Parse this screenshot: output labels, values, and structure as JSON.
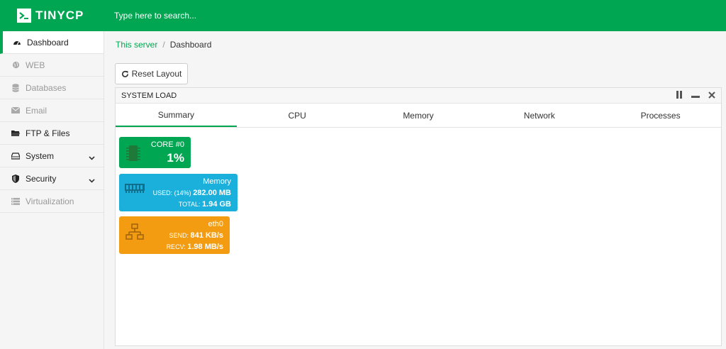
{
  "app": {
    "logo_text": "TINYCP"
  },
  "search": {
    "placeholder": "Type here to search..."
  },
  "sidebar": {
    "items": [
      {
        "label": "Dashboard",
        "icon": "dashboard-icon"
      },
      {
        "label": "WEB",
        "icon": "globe-icon"
      },
      {
        "label": "Databases",
        "icon": "database-icon"
      },
      {
        "label": "Email",
        "icon": "envelope-icon"
      },
      {
        "label": "FTP & Files",
        "icon": "folder-icon"
      },
      {
        "label": "System",
        "icon": "drive-icon"
      },
      {
        "label": "Security",
        "icon": "shield-icon"
      },
      {
        "label": "Virtualization",
        "icon": "server-list-icon"
      }
    ]
  },
  "breadcrumb": {
    "root": "This server",
    "separator": "/",
    "current": "Dashboard"
  },
  "toolbar": {
    "reset_label": "Reset Layout"
  },
  "panel": {
    "title": "SYSTEM LOAD",
    "tabs": [
      "Summary",
      "CPU",
      "Memory",
      "Network",
      "Processes"
    ],
    "cards": {
      "cpu": {
        "title": "CORE #0",
        "value": "1%"
      },
      "memory": {
        "title": "Memory",
        "used_label": "USED: (14%)",
        "used_value": "282.00 MB",
        "total_label": "TOTAL:",
        "total_value": "1.94 GB"
      },
      "network": {
        "title": "eth0",
        "send_label": "SEND:",
        "send_value": "841 KB/s",
        "recv_label": "RECV:",
        "recv_value": "1.98 MB/s"
      }
    }
  },
  "colors": {
    "accent": "#00a651",
    "memory": "#1ab0db",
    "network": "#f39c12"
  }
}
